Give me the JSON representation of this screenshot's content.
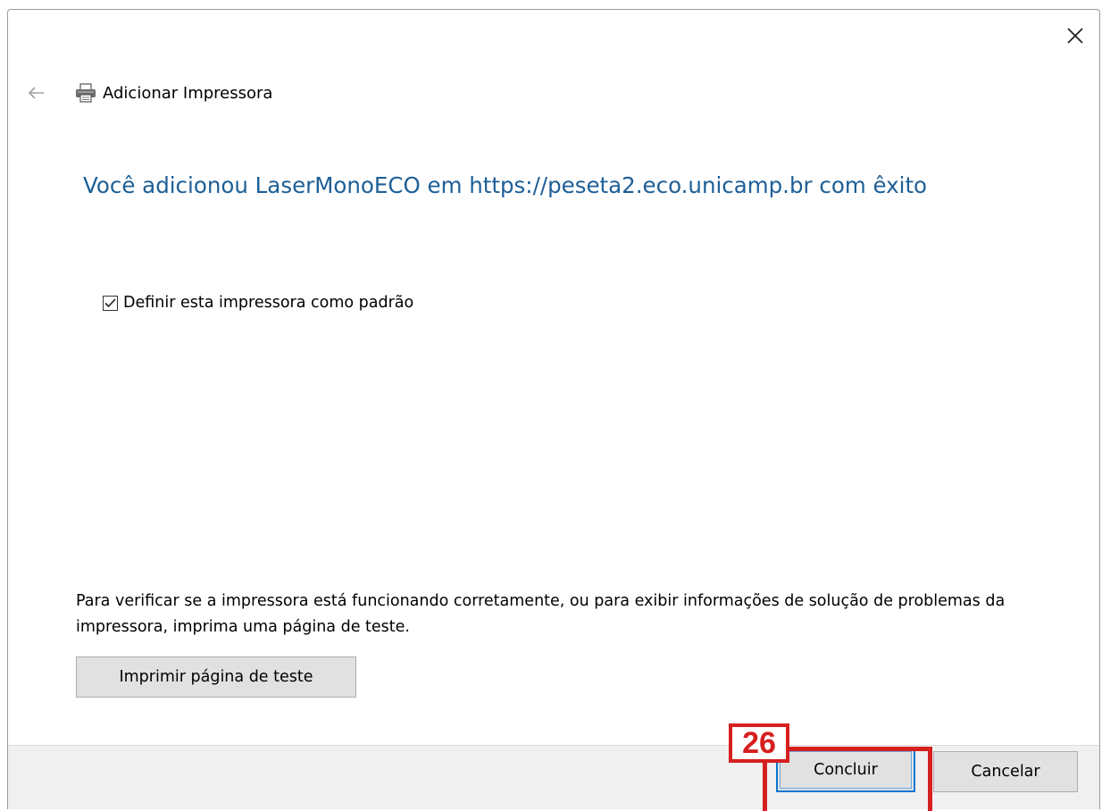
{
  "window": {
    "title": "Adicionar Impressora",
    "close_icon": "close-icon",
    "back_icon": "back-arrow-icon",
    "title_icon": "printer-icon"
  },
  "main": {
    "heading": "Você adicionou LaserMonoECO em https://peseta2.eco.unicamp.br com êxito",
    "default_checkbox": {
      "label": "Definir esta impressora como padrão",
      "checked": true
    },
    "info_text": "Para verificar se a impressora está funcionando corretamente, ou para exibir informações de solução de problemas da impressora, imprima uma página de teste.",
    "test_page_button": "Imprimir página de teste"
  },
  "footer": {
    "finish_button": "Concluir",
    "cancel_button": "Cancelar"
  },
  "annotation": {
    "step_number": "26",
    "color": "#d61f1f"
  },
  "colors": {
    "heading": "#1d5f97",
    "focus_border": "#0a77d4",
    "button_bg": "#e1e1e1",
    "footer_bg": "#f0f0f0"
  }
}
